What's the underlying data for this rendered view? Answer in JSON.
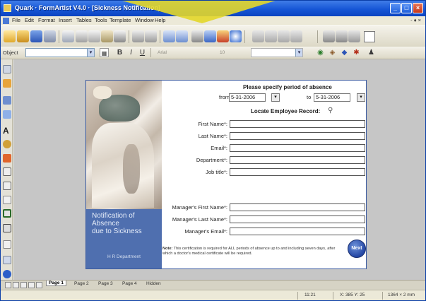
{
  "window": {
    "title": "Quark · FormArtist V4.0 · [Sickness Notification]",
    "minimize_glyph": "_",
    "maximize_glyph": "□",
    "close_glyph": "×"
  },
  "menu": [
    "File",
    "Edit",
    "Format",
    "Insert",
    "Tables",
    "Tools",
    "Template",
    "Window",
    "Help"
  ],
  "menu_right": "- ♦ ×",
  "toolbar2": {
    "object_label": "Object",
    "bold": "B",
    "italic": "I",
    "underline": "U",
    "font_placeholder": "Arial",
    "size_placeholder": "10"
  },
  "form": {
    "period_title": "Please specify period of absence",
    "from_label": "from",
    "from_value": "5-31-2006",
    "to_label": "to",
    "to_value": "5-31-2006",
    "locate_title": "Locate Employee Record:",
    "fields": [
      {
        "label": "First Name*:"
      },
      {
        "label": "Last Name*:"
      },
      {
        "label": "Email*:"
      },
      {
        "label": "Department*:"
      },
      {
        "label": "Job title*:"
      }
    ],
    "manager_fields": [
      {
        "label": "Manager's First Name*:"
      },
      {
        "label": "Manager's Last Name*:"
      },
      {
        "label": "Manager's Email*:"
      }
    ],
    "note_bold": "Note:",
    "note_text": " This certification is required for ALL periods of absence up to and including seven days, after which a doctor's medical certificate will be required.",
    "next_label": "Next",
    "panel_title": "Notification of\nAbsence\ndue to Sickness",
    "panel_footer": "H R Department"
  },
  "page_tabs": [
    "Page 1",
    "Page 2",
    "Page 3",
    "Page 4",
    "Hidden"
  ],
  "status": {
    "left": "",
    "pos1": "11:21",
    "pos2": "X: 385  Y: 25",
    "pos3": "1364 × 2 mm"
  },
  "colors": {
    "titlebar": "#1656d6",
    "panel_blue": "#4f6faf",
    "accent_yellow": "#e3d72a"
  }
}
